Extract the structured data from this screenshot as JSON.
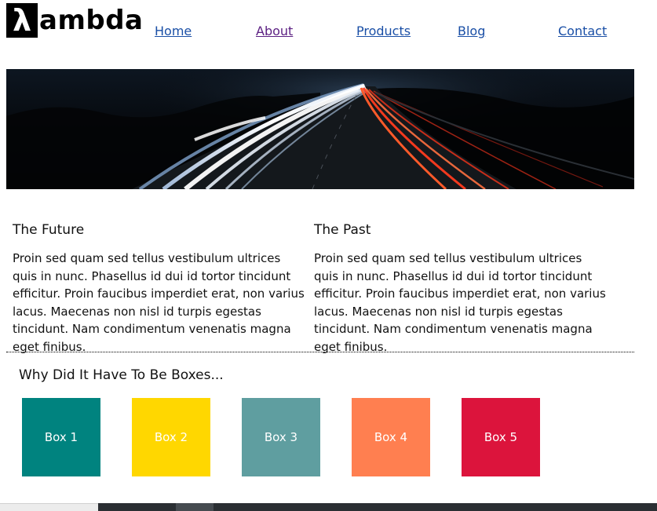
{
  "logo": {
    "mark": "λ",
    "text": "ambda"
  },
  "nav": {
    "items": [
      {
        "label": "Home"
      },
      {
        "label": "About"
      },
      {
        "label": "Products"
      },
      {
        "label": "Blog"
      },
      {
        "label": "Contact"
      }
    ]
  },
  "sections": [
    {
      "title": "The Future",
      "body": "Proin sed quam sed tellus vestibulum ultrices quis in nunc. Phasellus id dui id tortor tincidunt efficitur. Proin faucibus imperdiet erat, non varius lacus. Maecenas non nisl id turpis egestas tincidunt. Nam condimentum venenatis magna eget finibus."
    },
    {
      "title": "The Past",
      "body": "Proin sed quam sed tellus vestibulum ultrices quis in nunc. Phasellus id dui id tortor tincidunt efficitur. Proin faucibus imperdiet erat, non varius lacus. Maecenas non nisl id turpis egestas tincidunt. Nam condimentum venenatis magna eget finibus."
    }
  ],
  "boxes": {
    "title": "Why Did It Have To Be Boxes...",
    "items": [
      {
        "label": "Box 1",
        "color": "#00837f"
      },
      {
        "label": "Box 2",
        "color": "#ffd700"
      },
      {
        "label": "Box 3",
        "color": "#5f9ea0"
      },
      {
        "label": "Box 4",
        "color": "#ff7f50"
      },
      {
        "label": "Box 5",
        "color": "#dc143c"
      }
    ]
  },
  "colors": {
    "link": "#1a4fa6",
    "link_visited": "#5b1f82"
  }
}
